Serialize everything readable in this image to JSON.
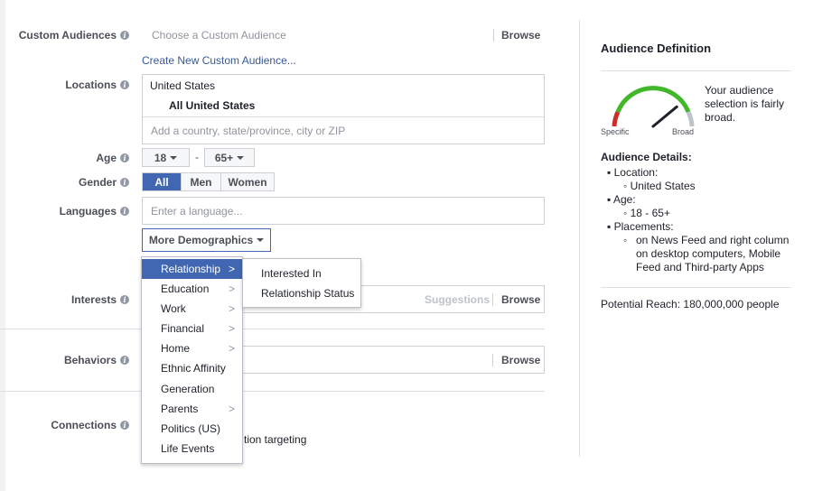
{
  "custom_audiences": {
    "label": "Custom Audiences",
    "placeholder": "Choose a Custom Audience",
    "browse": "Browse",
    "create_link": "Create New Custom Audience..."
  },
  "locations": {
    "label": "Locations",
    "country": "United States",
    "selection": "All United States",
    "placeholder": "Add a country, state/province, city or ZIP"
  },
  "age": {
    "label": "Age",
    "min": "18",
    "dash": "-",
    "max": "65+"
  },
  "gender": {
    "label": "Gender",
    "options": [
      "All",
      "Men",
      "Women"
    ],
    "selected": "All"
  },
  "languages": {
    "label": "Languages",
    "placeholder": "Enter a language..."
  },
  "more_demographics": {
    "label": "More Demographics"
  },
  "interests": {
    "label": "Interests",
    "suggestions": "Suggestions",
    "browse": "Browse"
  },
  "behaviors": {
    "label": "Behaviors",
    "browse": "Browse"
  },
  "connections": {
    "label": "Connections",
    "partial_text": "tion targeting"
  },
  "demographics_menu": {
    "items": [
      {
        "label": "Relationship",
        "has_sub": true,
        "selected": true
      },
      {
        "label": "Education",
        "has_sub": true
      },
      {
        "label": "Work",
        "has_sub": true
      },
      {
        "label": "Financial",
        "has_sub": true
      },
      {
        "label": "Home",
        "has_sub": true
      },
      {
        "label": "Ethnic Affinity",
        "has_sub": false
      },
      {
        "label": "Generation",
        "has_sub": false
      },
      {
        "label": "Parents",
        "has_sub": true
      },
      {
        "label": "Politics (US)",
        "has_sub": false
      },
      {
        "label": "Life Events",
        "has_sub": false
      }
    ],
    "submenu": [
      "Interested In",
      "Relationship Status"
    ]
  },
  "audience_definition": {
    "title": "Audience Definition",
    "gauge_text": "Your audience selection is fairly broad.",
    "specific": "Specific",
    "broad": "Broad",
    "gauge_level": 0.78,
    "details_title": "Audience Details:",
    "location_label": "Location:",
    "location_value": "United States",
    "age_label": "Age:",
    "age_value": "18 - 65+",
    "placements_label": "Placements:",
    "placements_value": "on News Feed and right column on desktop computers, Mobile Feed and Third-party Apps",
    "potential_reach": "Potential Reach: 180,000,000 people"
  },
  "colors": {
    "accent": "#4267b2",
    "gauge_red": "#c9302c",
    "gauge_green": "#42b72a"
  }
}
